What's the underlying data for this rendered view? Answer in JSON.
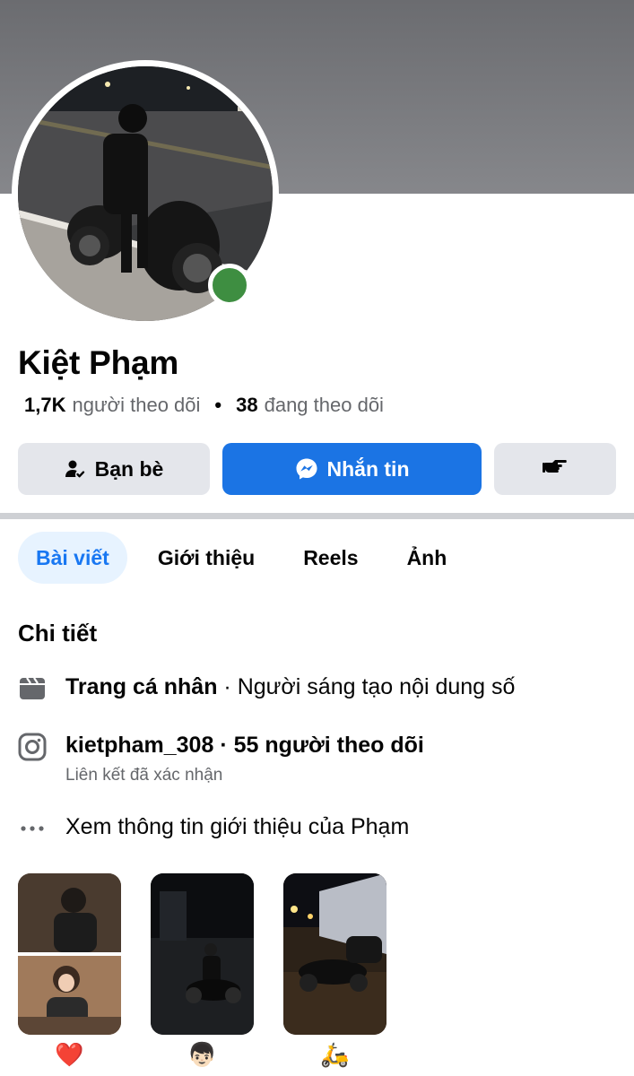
{
  "profile": {
    "name": "Kiệt Phạm",
    "followers_count": "1,7K",
    "followers_label": "người theo dõi",
    "separator": "•",
    "following_count": "38",
    "following_label": "đang theo dõi",
    "online_status_color": "#3e8e41"
  },
  "actions": {
    "friends_label": "Bạn bè",
    "message_label": "Nhắn tin",
    "more_icon": "poke-hand-icon",
    "message_color": "#1b74e4"
  },
  "tabs": [
    {
      "label": "Bài viết",
      "active": true
    },
    {
      "label": "Giới thiệu",
      "active": false
    },
    {
      "label": "Reels",
      "active": false
    },
    {
      "label": "Ảnh",
      "active": false
    }
  ],
  "details": {
    "title": "Chi tiết",
    "page_type_bold": "Trang cá nhân",
    "page_type_rest": " · Người sáng tạo nội dung số",
    "instagram_handle": "kietpham_308 · 55 người theo dõi",
    "instagram_sub": "Liên kết đã xác nhận",
    "see_more": "Xem thông tin giới thiệu của Phạm"
  },
  "featured": [
    {
      "emoji": "❤️"
    },
    {
      "emoji": "👦🏻"
    },
    {
      "emoji": "🛵"
    }
  ]
}
